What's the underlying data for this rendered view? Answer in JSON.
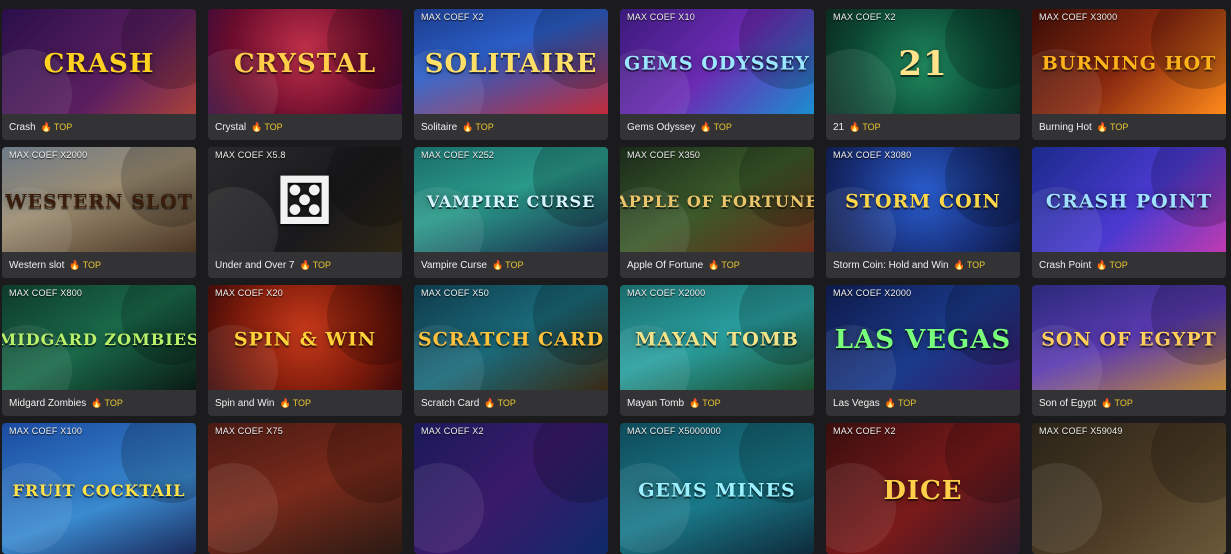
{
  "top_label": "TOP",
  "flame_glyph": "🔥",
  "accent_color": "#e8c630",
  "games": [
    {
      "name": "Crash",
      "coef": "",
      "art": "CRASH",
      "bg": "linear-gradient(135deg,#2a0f4a,#5b1f60 60%,#a8413a)",
      "art_color": "#ffd21f"
    },
    {
      "name": "Crystal",
      "coef": "",
      "art": "CRYSTAL",
      "bg": "radial-gradient(circle at 50% 40%,#c2304a,#6a0c2c 65%,#3a0b3d)",
      "art_color": "#ffcd4a"
    },
    {
      "name": "Solitaire",
      "coef": "MAX COEF X2",
      "art": "SOLITAIRE",
      "bg": "linear-gradient(160deg,#1c3b8a,#2a5ec7 40%,#c02b3a)",
      "art_color": "#ffe066"
    },
    {
      "name": "Gems Odyssey",
      "coef": "MAX COEF X10",
      "art": "GEMS ODYSSEY",
      "bg": "linear-gradient(135deg,#3b1a7a,#6b2bb3 50%,#1a8fd0)",
      "art_color": "#9be7ff"
    },
    {
      "name": "21",
      "coef": "MAX COEF X2",
      "art": "21",
      "bg": "radial-gradient(circle at 50% 55%,#1f8a5f,#0c4a35 60%,#0a2a20)",
      "art_color": "#ffe28a"
    },
    {
      "name": "Burning Hot",
      "coef": "MAX COEF X3000",
      "art": "BURNING HOT",
      "bg": "linear-gradient(135deg,#3a0d06,#8a2a10 50%,#ff8a1a)",
      "art_color": "#ffb31a"
    },
    {
      "name": "Western slot",
      "coef": "MAX COEF X2000",
      "art": "WESTERN SLOT",
      "bg": "linear-gradient(160deg,#6c7a88,#9c8d72 45%,#4a3522)",
      "art_color": "#3a1d0a"
    },
    {
      "name": "Under and Over 7",
      "coef": "MAX COEF X5.8",
      "art": "⚄",
      "bg": "linear-gradient(135deg,#2a2a2c,#1a1a1c 60%,#2e2614)",
      "art_color": "#f2f2f2"
    },
    {
      "name": "Vampire Curse",
      "coef": "MAX COEF X252",
      "art": "VAMPIRE CURSE",
      "bg": "linear-gradient(160deg,#1a6c6a,#2a9a8a 45%,#1a2b4a)",
      "art_color": "#d8f4ff"
    },
    {
      "name": "Apple Of Fortune",
      "coef": "MAX COEF X350",
      "art": "APPLE OF FORTUNE",
      "bg": "linear-gradient(150deg,#1a2a1a,#3b5a2a 50%,#6a2a1a)",
      "art_color": "#e9c46a"
    },
    {
      "name": "Storm Coin: Hold and Win",
      "coef": "MAX COEF X3080",
      "art": "STORM COIN",
      "bg": "radial-gradient(circle at 50% 45%,#2a5ed0,#18307a 60%,#0e1a44)",
      "art_color": "#ffd84a"
    },
    {
      "name": "Crash Point",
      "coef": "",
      "art": "CRASH POINT",
      "bg": "linear-gradient(135deg,#1a2a8a,#4a3ad0 55%,#c03ab0)",
      "art_color": "#9fe1ff"
    },
    {
      "name": "Midgard Zombies",
      "coef": "MAX COEF X800",
      "art": "MIDGARD ZOMBIES",
      "bg": "linear-gradient(150deg,#0e3a2a,#1a6a4a 50%,#0a1a14)",
      "art_color": "#b8f06a"
    },
    {
      "name": "Spin and Win",
      "coef": "MAX COEF X20",
      "art": "SPIN & WIN",
      "bg": "radial-gradient(circle at 50% 45%,#c83a1a,#7a1a0a 60%,#3a0a0a)",
      "art_color": "#ffd23a"
    },
    {
      "name": "Scratch Card",
      "coef": "MAX COEF X50",
      "art": "SCRATCH CARD",
      "bg": "linear-gradient(150deg,#0e3a4a,#1a6a7a 50%,#3a2a14)",
      "art_color": "#ffc23a"
    },
    {
      "name": "Mayan Tomb",
      "coef": "MAX COEF X2000",
      "art": "MAYAN TOMB",
      "bg": "linear-gradient(160deg,#1a6a6a,#2aa0a0 50%,#1a4a2a)",
      "art_color": "#f2e38a"
    },
    {
      "name": "Las Vegas",
      "coef": "MAX COEF X2000",
      "art": "LAS VEGAS",
      "bg": "linear-gradient(140deg,#0e1a4a,#1a3a8a 55%,#3a1a6a)",
      "art_color": "#7aff7a"
    },
    {
      "name": "Son of Egypt",
      "coef": "",
      "art": "SON OF EGYPT",
      "bg": "linear-gradient(160deg,#2a2a7a,#5a3ab0 50%,#c08a3a)",
      "art_color": "#ffcf5a"
    },
    {
      "name": "",
      "coef": "MAX COEF X100",
      "art": "FRUIT COCKTAIL",
      "bg": "linear-gradient(160deg,#1a4aa0,#3a8ad0 60%,#1a2a5a)",
      "art_color": "#ffe14a"
    },
    {
      "name": "",
      "coef": "MAX COEF X75",
      "art": "",
      "bg": "linear-gradient(160deg,#4a1a14,#7a2a1a 50%,#2a1a14)",
      "art_color": "#ffffff"
    },
    {
      "name": "",
      "coef": "MAX COEF X2",
      "art": "",
      "bg": "linear-gradient(135deg,#1a1a5a,#3a1a6a 50%,#0e2a6a)",
      "art_color": "#ffffff"
    },
    {
      "name": "",
      "coef": "MAX COEF X5000000",
      "art": "GEMS MINES",
      "bg": "linear-gradient(160deg,#0e4a5a,#1a7a8a 55%,#0e2a3a)",
      "art_color": "#9bf0ff"
    },
    {
      "name": "",
      "coef": "MAX COEF X2",
      "art": "DICE",
      "bg": "linear-gradient(140deg,#3a0e0e,#7a1a1a 55%,#2a1a2a)",
      "art_color": "#ffcf4a"
    },
    {
      "name": "",
      "coef": "MAX COEF X59049",
      "art": "",
      "bg": "linear-gradient(140deg,#2a2418,#4a3a24 55%,#6a5a3a)",
      "art_color": "#ffffff"
    }
  ]
}
